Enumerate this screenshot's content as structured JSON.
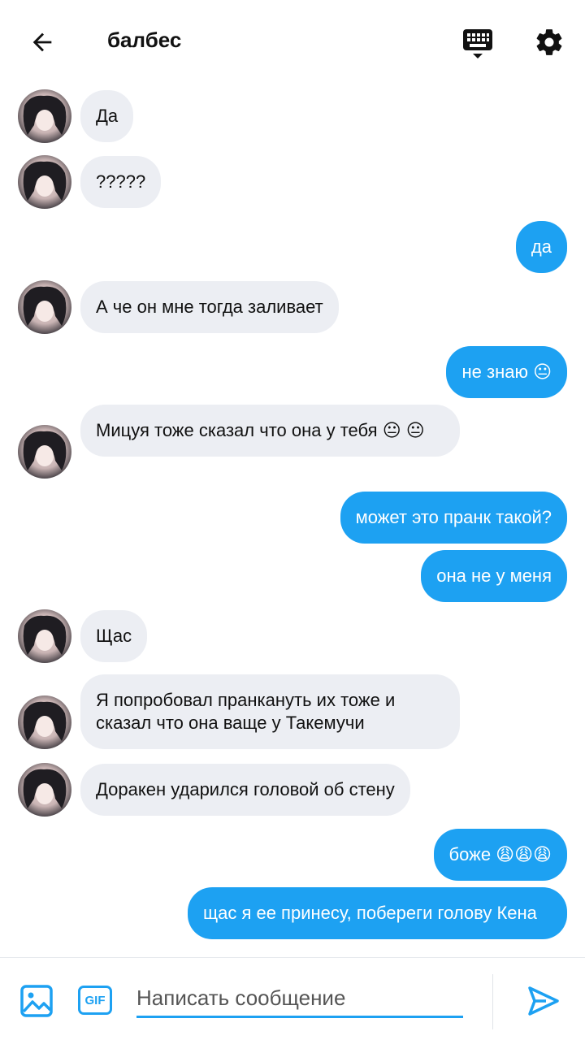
{
  "header": {
    "title": "балбес",
    "back_icon": "arrow-left-icon",
    "keyboard_icon": "keyboard-icon",
    "settings_icon": "gear-icon"
  },
  "messages": [
    {
      "side": "in",
      "text": "Да"
    },
    {
      "side": "in",
      "text": "?????"
    },
    {
      "side": "out",
      "text": "да"
    },
    {
      "side": "in",
      "text": "А че он мне тогда заливает"
    },
    {
      "side": "out",
      "text": "не знаю 😐"
    },
    {
      "side": "in",
      "text": "Мицуя тоже сказал что она у тебя 😐 😐"
    },
    {
      "side": "out",
      "text": "может это пранк такой?"
    },
    {
      "side": "out",
      "text": "она не у меня"
    },
    {
      "side": "in",
      "text": "Щас"
    },
    {
      "side": "in",
      "text": "Я попробовал пранкануть их тоже и сказал что она ваще у Такемучи"
    },
    {
      "side": "in",
      "text": "Доракен ударился головой об стену"
    },
    {
      "side": "out",
      "text": "боже 😩😩😩"
    },
    {
      "side": "out",
      "text": "щас я ее принесу, побереги голову Кена"
    }
  ],
  "composer": {
    "placeholder": "Написать сообщение",
    "gif_label": "GIF",
    "image_icon": "image-icon",
    "send_icon": "send-icon"
  },
  "colors": {
    "accent": "#1da1f2",
    "incoming_bubble": "#eceef3",
    "outgoing_text": "#ffffff"
  }
}
